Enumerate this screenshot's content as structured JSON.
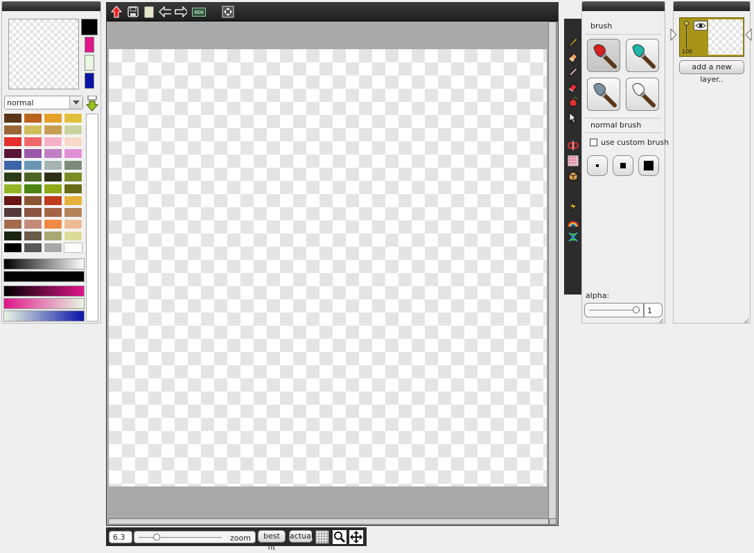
{
  "toolbar": {
    "icons": [
      "upload-icon",
      "save-icon",
      "page-icon",
      "undo-arrow-icon",
      "redo-arrow-icon",
      "new-icon",
      "fit-frame-icon"
    ],
    "new_label": "NEW"
  },
  "colors": {
    "primary": "#000000",
    "recent": [
      "#e0168a",
      "#e8f6e2",
      "#0a14a6"
    ],
    "palette": [
      [
        "#5a3518",
        "#b9631f",
        "#e3a02a",
        "#e0c03a"
      ],
      [
        "#9a6638",
        "#d1bd5a",
        "#c79d52",
        "#c7d29e"
      ],
      [
        "#e5302e",
        "#f2686a",
        "#f6b0c8",
        "#f8d8c8"
      ],
      [
        "#5a1636",
        "#9a58a8",
        "#c080c4",
        "#e090d4"
      ],
      [
        "#3c64a8",
        "#6a96b4",
        "#a4b4b4",
        "#7a8c7a"
      ],
      [
        "#2c3c16",
        "#4a6424",
        "#2c3016",
        "#7c8c26"
      ],
      [
        "#94b426",
        "#4c8414",
        "#8caa18",
        "#6a6a14"
      ],
      [
        "#6a1612",
        "#8c5432",
        "#c03c1c",
        "#e6b03c"
      ],
      [
        "#543a3a",
        "#8c5242",
        "#a46444",
        "#b48458"
      ],
      [
        "#a46a4a",
        "#c48a7a",
        "#ee8a44",
        "#eebc94"
      ],
      [
        "#1c2412",
        "#6a5a4a",
        "#a8aa74",
        "#dcdc9a"
      ],
      [
        "#000000",
        "#585858",
        "#a8a8a8",
        "#ffffff"
      ]
    ],
    "gradients": [
      [
        "#000000",
        "#ffffff"
      ],
      [
        "#000000",
        "#000000"
      ],
      [
        "#000000",
        "#e0168a"
      ],
      [
        "#e0168a",
        "#e8f6e2"
      ],
      [
        "#e8f6e2",
        "#0a14a6"
      ]
    ]
  },
  "blend_mode": {
    "value": "normal"
  },
  "side_tools": [
    "pencil-icon",
    "eraser-icon",
    "pen-icon",
    "ink-icon",
    "bucket-icon",
    "pointer-icon",
    "mirror-icon",
    "pattern-icon",
    "box-icon",
    "lightning-icon",
    "rainbow-icon",
    "dna-icon"
  ],
  "brush_panel": {
    "title": "brush",
    "brushes": [
      {
        "name": "red-brush",
        "tip": "#d42020"
      },
      {
        "name": "teal-brush",
        "tip": "#22b4a8"
      },
      {
        "name": "gray-brush",
        "tip": "#7890a4"
      },
      {
        "name": "white-brush",
        "tip": "#f4f4f4"
      }
    ],
    "current": "normal brush",
    "custom_label": "use custom brush",
    "custom_checked": false,
    "alpha_label": "alpha:",
    "alpha_value": "1",
    "alpha_fraction": 0.93
  },
  "layers": {
    "layer_opacity": "100",
    "add_label": "add a new layer.."
  },
  "zoom": {
    "value": "6.3",
    "label": "zoom",
    "fraction": 0.19,
    "best_fit_label": "best fit",
    "actual_label": "actual"
  },
  "bottom_icons": [
    "grid-icon",
    "magnifier-icon",
    "move-icon"
  ]
}
